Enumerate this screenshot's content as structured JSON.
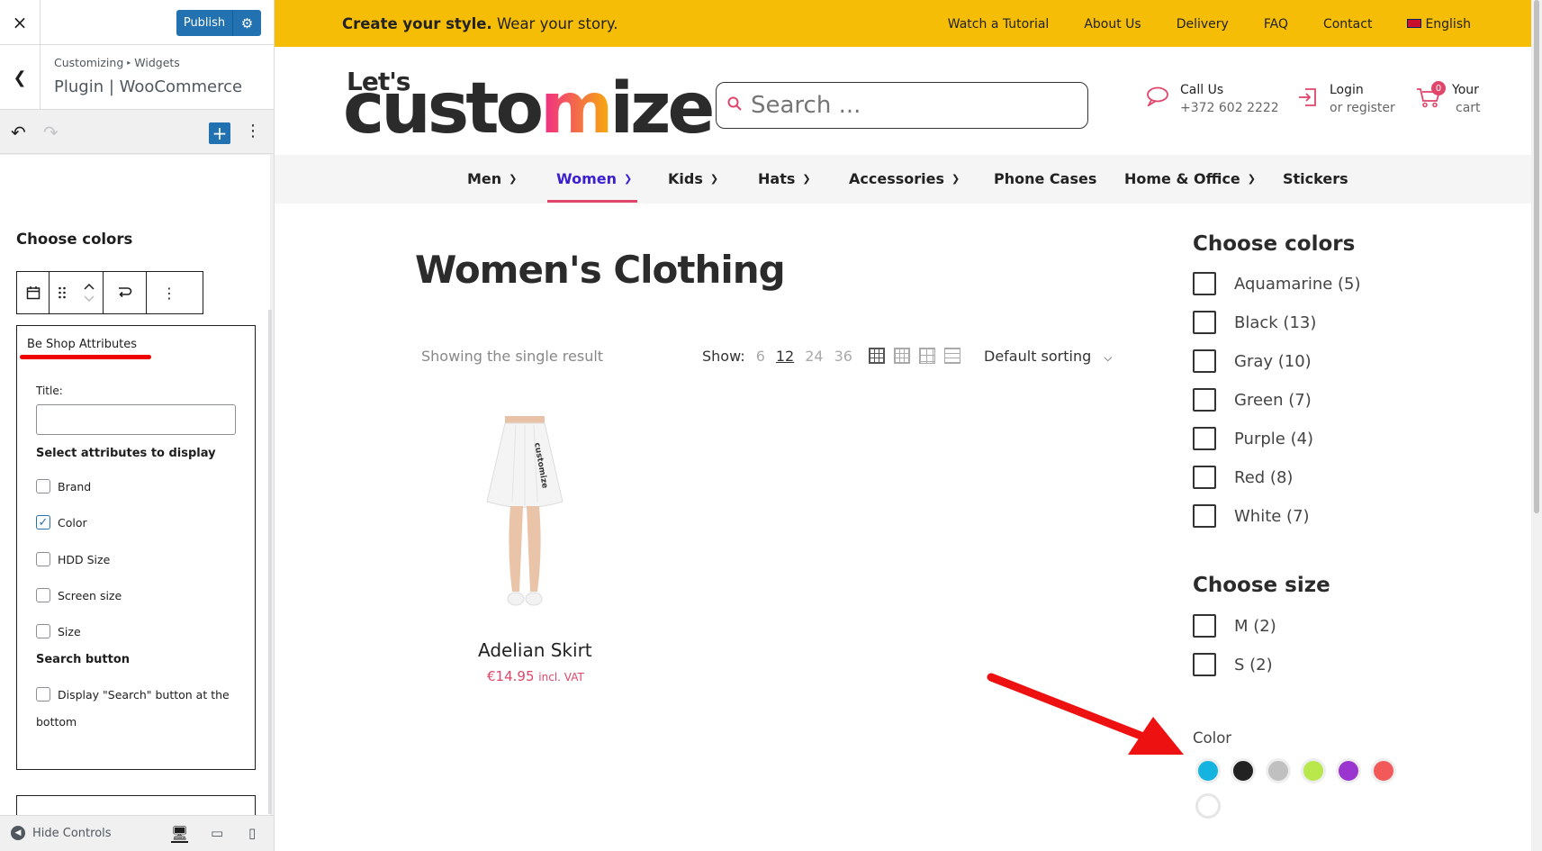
{
  "customizer": {
    "close_label": "×",
    "publish_label": "Publish",
    "gear_icon": "⚙",
    "breadcrumb": [
      "Customizing",
      "Widgets"
    ],
    "breadcrumb_sep": "▸",
    "panel_title": "Plugin | WooCommerce",
    "undo_icon": "↶",
    "redo_icon": "↷",
    "add_icon": "+",
    "more_icon": "⋮",
    "block_heading": "Choose colors",
    "toolbar_icons": [
      "calendar-icon",
      "drag-handle-icon",
      "move-updown-icon",
      "transform-icon",
      "more-options-icon"
    ],
    "widget": {
      "title": "Be Shop Attributes",
      "title_label": "Title:",
      "title_value": "",
      "select_heading": "Select attributes to display",
      "attributes": [
        {
          "label": "Brand",
          "checked": false
        },
        {
          "label": "Color",
          "checked": true
        },
        {
          "label": "HDD Size",
          "checked": false
        },
        {
          "label": "Screen size",
          "checked": false
        },
        {
          "label": "Size",
          "checked": false
        }
      ],
      "search_heading": "Search button",
      "search_option_line1": "Display \"Search\" button at the",
      "search_option_line2": "bottom"
    },
    "footer": {
      "hide_controls": "Hide Controls"
    }
  },
  "site": {
    "topbar": {
      "tagline_bold": "Create your style.",
      "tagline_rest": " Wear your story.",
      "links": [
        "Watch a Tutorial",
        "About Us",
        "Delivery",
        "FAQ",
        "Contact"
      ],
      "language": "English",
      "bg_color": "#f6bd07"
    },
    "logo": {
      "line1": "Let's",
      "main_before": "custo",
      "main_m": "m",
      "main_after": "ize"
    },
    "search_placeholder": "Search ...",
    "call": {
      "label": "Call Us",
      "phone": "+372 602 2222"
    },
    "login": {
      "label": "Login",
      "sub": "or register"
    },
    "cart": {
      "label": "Your",
      "sub": "cart",
      "count": "0"
    },
    "nav": [
      "Men",
      "Women",
      "Kids",
      "Hats",
      "Accessories",
      "Phone Cases",
      "Home & Office",
      "Stickers"
    ],
    "nav_active": "Women",
    "page_title": "Women's Clothing",
    "results_text": "Showing the single result",
    "show_label": "Show:",
    "show_options": [
      "6",
      "12",
      "24",
      "36"
    ],
    "show_selected": "12",
    "sorting": "Default sorting",
    "product": {
      "name": "Adelian Skirt",
      "price": "€14.95",
      "price_note": "incl. VAT"
    },
    "filter_colors": {
      "heading": "Choose colors",
      "items": [
        "Aquamarine (5)",
        "Black (13)",
        "Gray (10)",
        "Green (7)",
        "Purple (4)",
        "Red (8)",
        "White (7)"
      ]
    },
    "filter_size": {
      "heading": "Choose size",
      "items": [
        "M (2)",
        "S (2)"
      ]
    },
    "color_widget": {
      "label": "Color",
      "swatches": [
        {
          "name": "aquamarine",
          "hex": "#14b3e0"
        },
        {
          "name": "black",
          "hex": "#222222"
        },
        {
          "name": "gray",
          "hex": "#c0c0c0"
        },
        {
          "name": "green",
          "hex": "#b8e84c"
        },
        {
          "name": "purple",
          "hex": "#9b35cf"
        },
        {
          "name": "red",
          "hex": "#f25a5a"
        },
        {
          "name": "white",
          "hex": "#ffffff"
        }
      ]
    },
    "accent_color": "#e0456a",
    "annotation_color": "#ee1111"
  }
}
